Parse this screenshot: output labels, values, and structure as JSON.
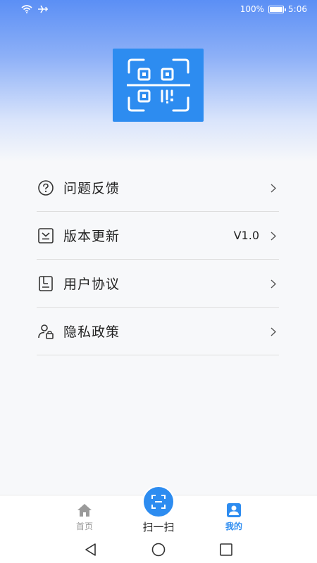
{
  "status_bar": {
    "battery": "100%",
    "time": "5:06"
  },
  "menu": [
    {
      "label": "问题反馈",
      "icon": "question-circle-icon"
    },
    {
      "label": "版本更新",
      "icon": "update-icon",
      "value": "V1.0"
    },
    {
      "label": "用户协议",
      "icon": "document-icon"
    },
    {
      "label": "隐私政策",
      "icon": "user-lock-icon"
    }
  ],
  "bottom_nav": {
    "home": "首页",
    "scan": "扫一扫",
    "mine": "我的"
  },
  "colors": {
    "accent": "#2d8cf0",
    "gradient_top": "#5b8ff5"
  }
}
